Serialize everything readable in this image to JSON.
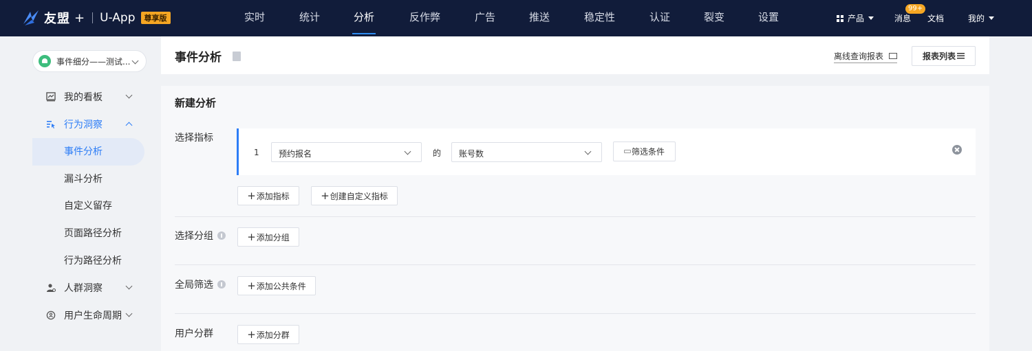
{
  "topbar": {
    "brand": "友盟",
    "brand_plus": "+",
    "app_name": "U-App",
    "edition_badge": "尊享版",
    "nav": [
      "实时",
      "统计",
      "分析",
      "反作弊",
      "广告",
      "推送",
      "稳定性",
      "认证",
      "裂变",
      "设置"
    ],
    "active_nav": "分析",
    "products_label": "产品",
    "messages_label": "消息",
    "messages_badge": "99+",
    "docs_label": "文档",
    "mine_label": "我的"
  },
  "sidebar": {
    "app_selector": "事件细分——测试...",
    "menu": {
      "dashboard": "我的看板",
      "behavior": "行为洞察",
      "behavior_items": [
        "事件分析",
        "漏斗分析",
        "自定义留存",
        "页面路径分析",
        "行为路径分析"
      ],
      "crowd": "人群洞察",
      "lifecycle": "用户生命周期"
    }
  },
  "header": {
    "title": "事件分析",
    "offline_report": "离线查询报表",
    "report_list": "报表列表"
  },
  "main": {
    "section_title": "新建分析",
    "metric_label": "选择指标",
    "metric": {
      "index": "1",
      "event": "预约报名",
      "connector": "的",
      "measure": "账号数",
      "filter_btn": "筛选条件"
    },
    "add_metric": "添加指标",
    "create_custom_metric": "创建自定义指标",
    "group_label": "选择分组",
    "add_group": "添加分组",
    "global_filter_label": "全局筛选",
    "add_common_condition": "添加公共条件",
    "segment_label": "用户分群",
    "add_segment": "添加分群"
  },
  "colors": {
    "topbar_bg": "#111c3a",
    "accent": "#2d7df6",
    "badge": "#f5a623"
  }
}
